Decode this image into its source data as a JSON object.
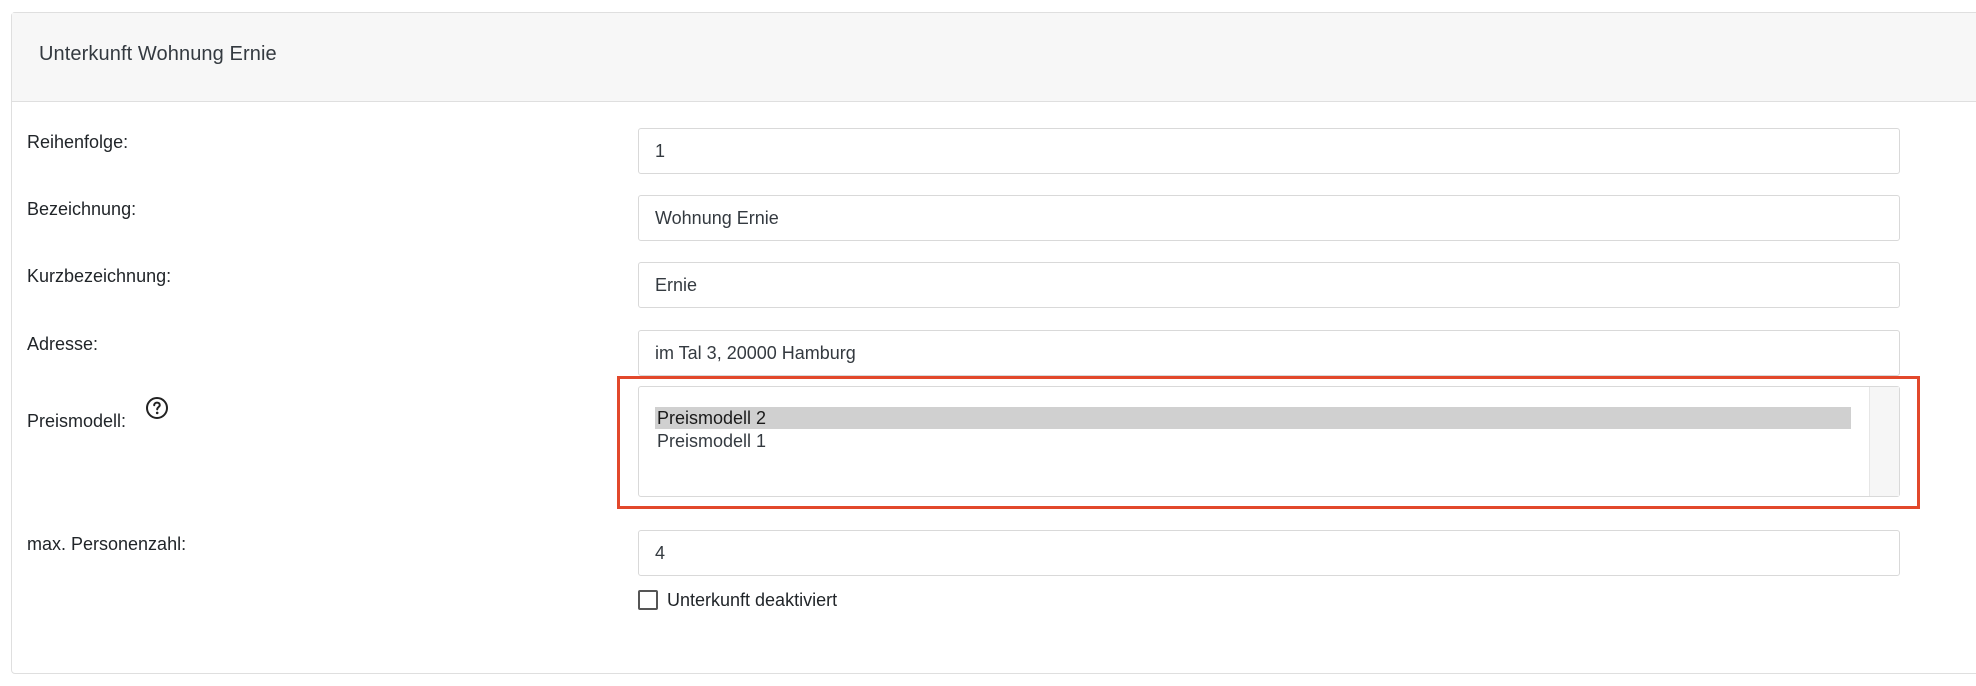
{
  "card": {
    "title": "Unterkunft Wohnung Ernie"
  },
  "form": {
    "order": {
      "label": "Reihenfolge:",
      "value": "1"
    },
    "name": {
      "label": "Bezeichnung:",
      "value": "Wohnung Ernie"
    },
    "short_name": {
      "label": "Kurzbezeichnung:",
      "value": "Ernie"
    },
    "address": {
      "label": "Adresse:",
      "value": "im Tal 3, 20000 Hamburg"
    },
    "price_model": {
      "label": "Preismodell:",
      "help_icon": "question-circle-icon",
      "options": [
        {
          "label": "Preismodell 2",
          "selected": true
        },
        {
          "label": "Preismodell 1",
          "selected": false
        }
      ]
    },
    "max_persons": {
      "label": "max. Personenzahl:",
      "value": "4"
    },
    "deactivated": {
      "label": "Unterkunft deaktiviert",
      "checked": false
    }
  },
  "colors": {
    "highlight_border": "#e2482b",
    "selected_option_bg": "#d0d0d0",
    "header_bg": "#f7f7f7"
  }
}
